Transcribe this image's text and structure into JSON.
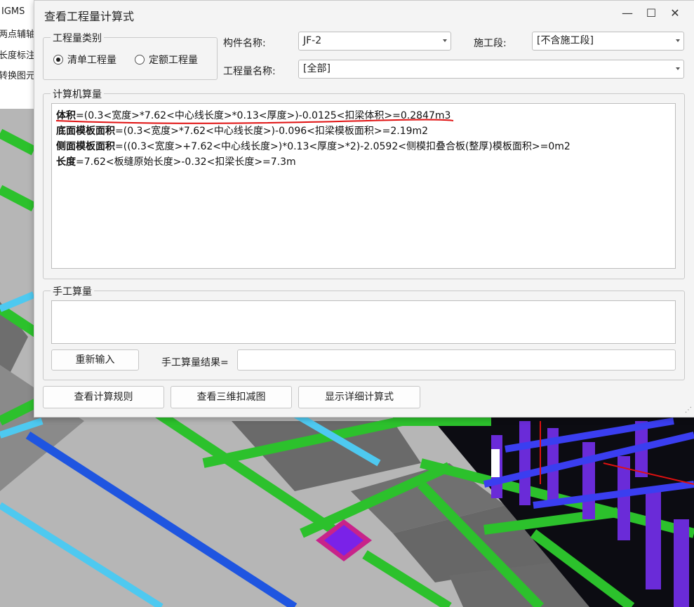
{
  "background_app": {
    "toolbar_items": [
      "IGMS",
      "两点辅轴",
      "长度标注",
      "转换图元"
    ]
  },
  "dialog": {
    "title": "查看工程量计算式",
    "window_buttons": {
      "minimize": "—",
      "maximize": "☐",
      "close": "✕"
    },
    "quantity_type": {
      "legend": "工程量类别",
      "options": [
        {
          "label": "清单工程量",
          "selected": true
        },
        {
          "label": "定额工程量",
          "selected": false
        }
      ]
    },
    "component_name": {
      "label": "构件名称:",
      "value": "JF-2"
    },
    "construction_section": {
      "label": "施工段:",
      "value": "[不含施工段]"
    },
    "quantity_name": {
      "label": "工程量名称:",
      "value": "[全部]"
    },
    "computer_calc": {
      "legend": "计算机算量",
      "lines": [
        {
          "name": "体积",
          "formula": "=(0.3<宽度>*7.62<中心线长度>*0.13<厚度>)-0.0125<扣梁体积>=0.2847m3"
        },
        {
          "name": "底面模板面积",
          "formula": "=(0.3<宽度>*7.62<中心线长度>)-0.096<扣梁模板面积>=2.19m2"
        },
        {
          "name": "侧面模板面积",
          "formula": "=((0.3<宽度>+7.62<中心线长度>)*0.13<厚度>*2)-2.0592<侧模扣叠合板(整厚)模板面积>=0m2"
        },
        {
          "name": "长度",
          "formula": "=7.62<板缝原始长度>-0.32<扣梁长度>=7.3m"
        }
      ]
    },
    "manual_calc": {
      "legend": "手工算量",
      "reenter_button": "重新输入",
      "result_label": "手工算量结果=",
      "result_value": ""
    },
    "bottom_buttons": {
      "view_rules": "查看计算规则",
      "view_3d": "查看三维扣减图",
      "show_detail": "显示详细计算式"
    }
  },
  "colors": {
    "slab_gray": "#b9b9b9",
    "beam_green": "#2cc12c",
    "beam_cyan": "#4ec9f0",
    "beam_blue": "#1f55e0",
    "column_purple": "#6a2bd8",
    "node_magenta": "#c8238a",
    "annotation_red": "#e01010"
  }
}
